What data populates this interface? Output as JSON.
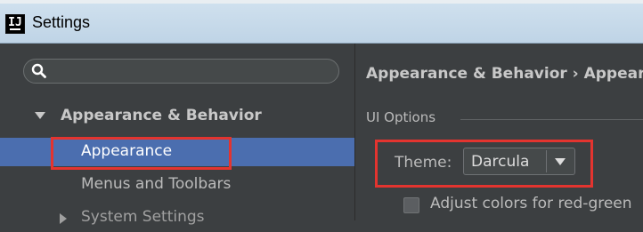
{
  "window": {
    "title": "Settings",
    "icon_glyph": "IJ"
  },
  "sidebar": {
    "search": {
      "placeholder": "",
      "icon": "search-icon"
    },
    "tree": [
      {
        "label": "Appearance & Behavior",
        "expanded": true,
        "icon": "caret-down-icon"
      },
      {
        "label": "Appearance",
        "selected": true
      },
      {
        "label": "Menus and Toolbars"
      },
      {
        "label": "System Settings",
        "expanded": false,
        "icon": "caret-right-icon"
      }
    ]
  },
  "content": {
    "breadcrumb": "Appearance & Behavior › Appear",
    "section": "UI Options",
    "theme": {
      "label": "Theme:",
      "value": "Darcula"
    },
    "checkbox": {
      "label": "Adjust colors for red-green",
      "checked": false
    }
  },
  "colors": {
    "background": "#3c3f41",
    "selection": "#4b6eaf",
    "highlight": "#e3342f",
    "titlebar": "#c6d9ea"
  }
}
